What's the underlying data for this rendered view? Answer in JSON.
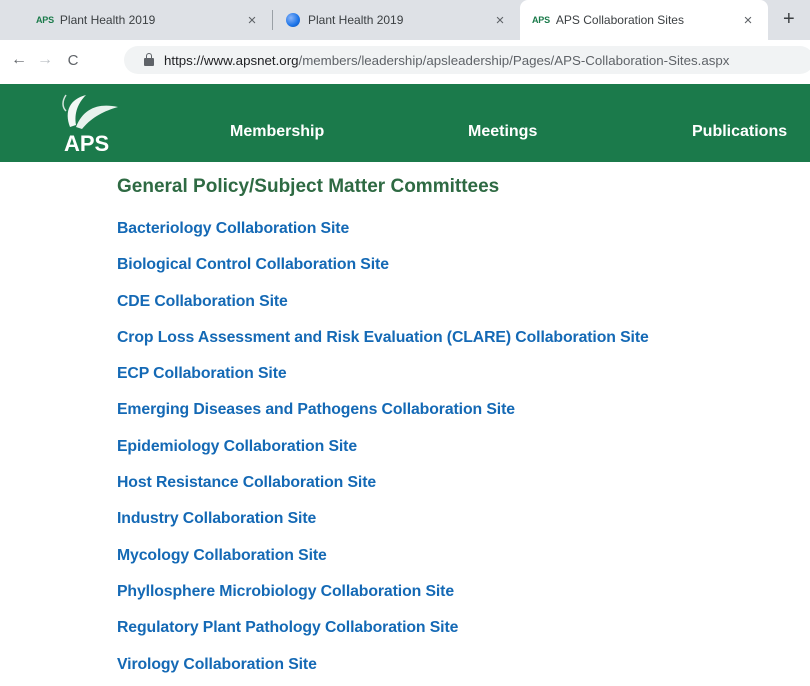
{
  "browser": {
    "tabs": [
      {
        "favicon": "APS",
        "title": "Plant Health 2019",
        "close": "×"
      },
      {
        "favicon": "globe-icon",
        "title": "Plant Health 2019",
        "close": "×"
      },
      {
        "favicon": "APS",
        "title": "APS Collaboration Sites",
        "close": "×",
        "active": true
      }
    ],
    "new_tab": "+",
    "nav": {
      "back": "←",
      "forward": "→",
      "reload": "C"
    },
    "url": {
      "host": "https://www.apsnet.org",
      "path": "/members/leadership/apsleadership/Pages/APS-Collaboration-Sites.aspx"
    }
  },
  "site": {
    "logo_text": "APS",
    "brand_color": "#1b7a4b",
    "nav": [
      "Membership",
      "Meetings",
      "Publications"
    ]
  },
  "main": {
    "heading": "General Policy/Subject Matter Committees",
    "links": [
      "Bacteriology Collaboration Site",
      "Biological Control Collaboration Site",
      "CDE Collaboration Site",
      "Crop Loss Assessment and Risk Evaluation (CLARE) Collaboration Site",
      "ECP Collaboration Site",
      "Emerging Diseases and Pathogens Collaboration Site",
      "Epidemiology Collaboration Site",
      "Host Resistance Collaboration Site",
      "Industry Collaboration Site",
      "Mycology Collaboration Site",
      "Phyllosphere Microbiology Collaboration Site",
      "Regulatory Plant Pathology Collaboration Site",
      "Virology Collaboration Site"
    ]
  }
}
